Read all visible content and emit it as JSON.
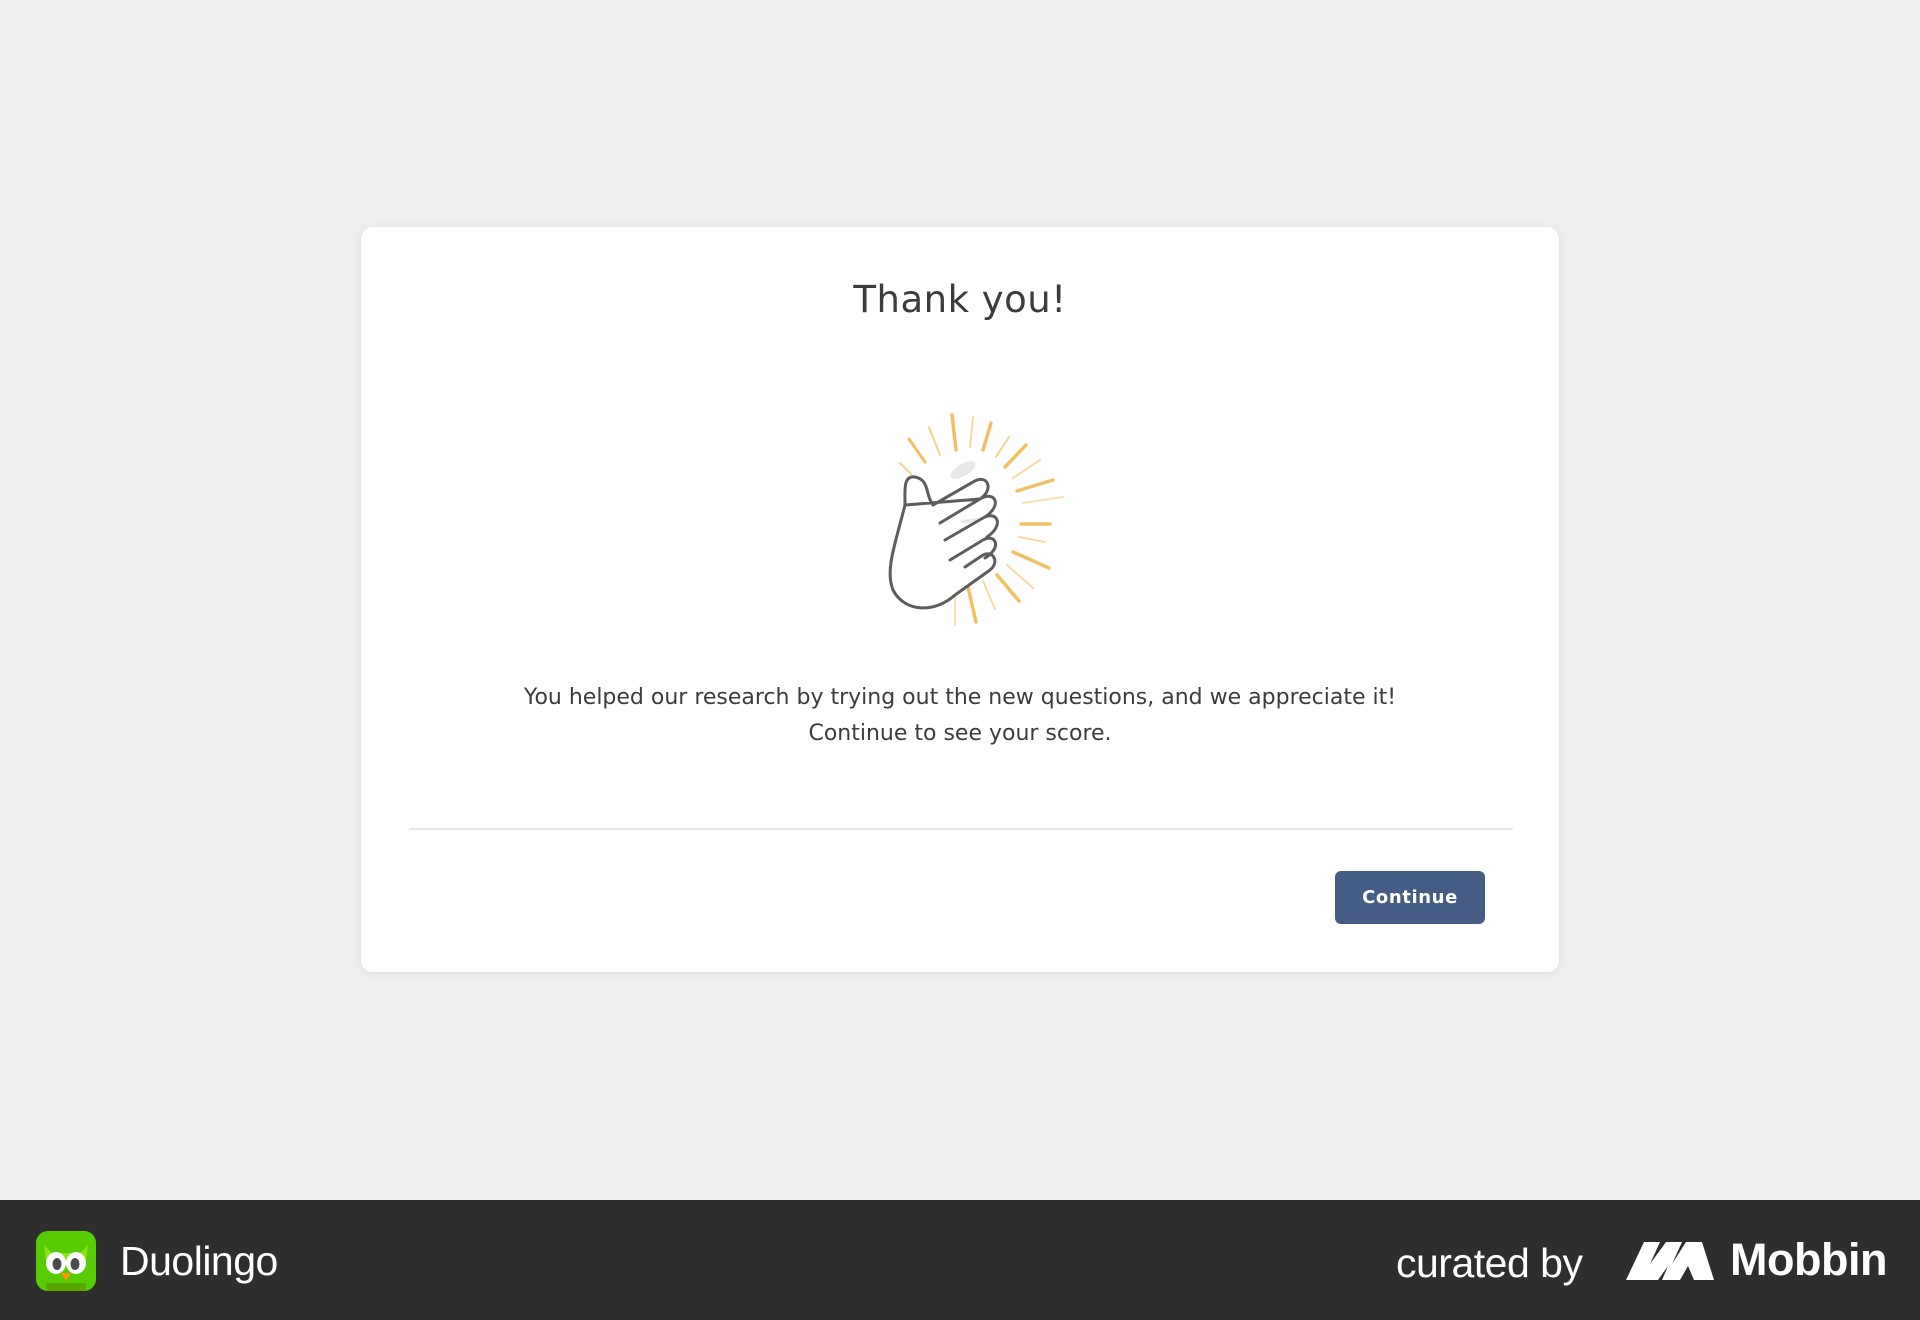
{
  "dialog": {
    "title": "Thank you!",
    "illustration_icon": "clapping-hands-icon",
    "message": "You helped our research by trying out the new questions, and we appreciate it! Continue to see your score.",
    "continue_label": "Continue"
  },
  "footer": {
    "app_icon": "duolingo-owl-icon",
    "app_name": "Duolingo",
    "curated_by": "curated by",
    "curator_icon": "mobbin-logo-icon",
    "curator_name": "Mobbin"
  },
  "colors": {
    "page_background": "#efefef",
    "card_background": "#ffffff",
    "button_background": "#455d85",
    "accent_burst": "#f0c164",
    "footer_background": "#2e2e2e",
    "duolingo_green": "#58cc02"
  }
}
